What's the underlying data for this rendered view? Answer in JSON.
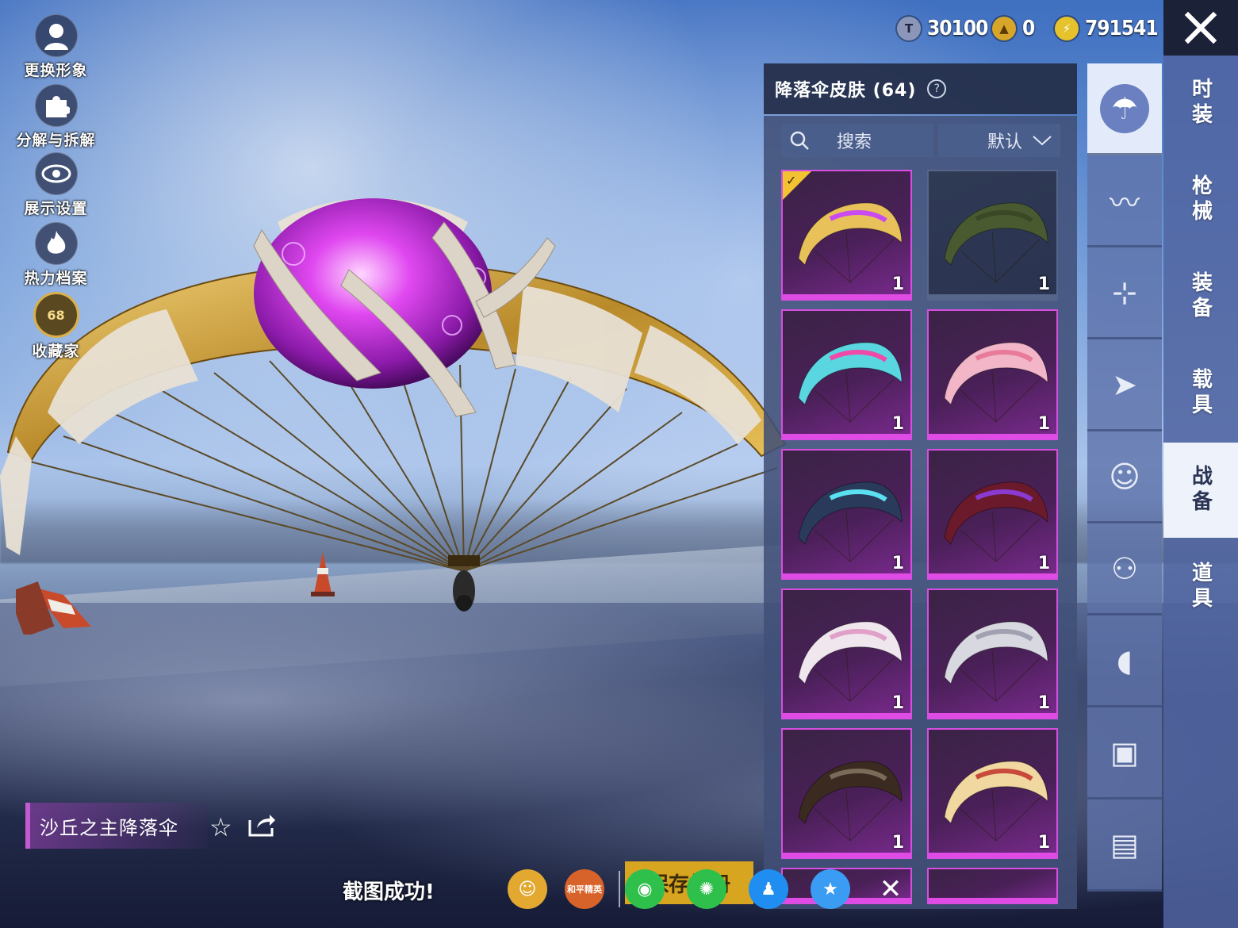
{
  "side_menu": [
    {
      "label": "更换形象",
      "icon": "avatar-icon"
    },
    {
      "label": "分解与拆解",
      "icon": "puzzle-icon"
    },
    {
      "label": "展示设置",
      "icon": "eye-icon"
    },
    {
      "label": "热力档案",
      "icon": "flame-icon"
    },
    {
      "label": "收藏家",
      "icon": "collector-badge-icon",
      "badge": "68"
    }
  ],
  "currencies": [
    {
      "icon": "silver-coin-icon",
      "value": "30100",
      "color": "#9aa4c0"
    },
    {
      "icon": "gold-coin-icon",
      "value": "0",
      "color": "#d6a52a"
    },
    {
      "icon": "energy-coin-icon",
      "value": "791541",
      "color": "#e6c22c"
    }
  ],
  "panel": {
    "title": "降落伞皮肤 (64)",
    "search_label": "搜索",
    "sort_label": "默认",
    "tiles": [
      {
        "name": "tile-dune-lord",
        "count": "1",
        "selected": true,
        "rarity": "purple"
      },
      {
        "name": "tile-olive-default",
        "count": "1",
        "selected": false,
        "rarity": "plain"
      },
      {
        "name": "tile-cyan-pink",
        "count": "1",
        "selected": false,
        "rarity": "purple"
      },
      {
        "name": "tile-pink-flower",
        "count": "1",
        "selected": false,
        "rarity": "purple"
      },
      {
        "name": "tile-cyber-disc",
        "count": "1",
        "selected": false,
        "rarity": "purple"
      },
      {
        "name": "tile-red-purple-diamond",
        "count": "1",
        "selected": false,
        "rarity": "purple"
      },
      {
        "name": "tile-white-pink",
        "count": "1",
        "selected": false,
        "rarity": "purple"
      },
      {
        "name": "tile-silver-crystal",
        "count": "1",
        "selected": false,
        "rarity": "purple"
      },
      {
        "name": "tile-dark-emblem",
        "count": "1",
        "selected": false,
        "rarity": "purple"
      },
      {
        "name": "tile-cartoon-print",
        "count": "1",
        "selected": false,
        "rarity": "purple"
      }
    ]
  },
  "icon_strip": [
    {
      "icon": "parachute-icon",
      "active": true
    },
    {
      "icon": "skydiver-icon",
      "active": false
    },
    {
      "icon": "drone-icon",
      "active": false
    },
    {
      "icon": "airplane-icon",
      "active": false
    },
    {
      "icon": "emote-face-icon",
      "active": false
    },
    {
      "icon": "robot-icon",
      "active": false
    },
    {
      "icon": "speaker-icon",
      "active": false
    },
    {
      "icon": "chat-bubble-icon",
      "active": false
    },
    {
      "icon": "gallery-icon",
      "active": false
    }
  ],
  "category_tabs": [
    {
      "label": "时装",
      "active": false
    },
    {
      "label": "枪械",
      "active": false
    },
    {
      "label": "装备",
      "active": false
    },
    {
      "label": "载具",
      "active": false
    },
    {
      "label": "战备",
      "active": true
    },
    {
      "label": "道具",
      "active": false
    }
  ],
  "selected_item": {
    "name": "沙丘之主降落伞"
  },
  "toast": {
    "text": "截图成功!"
  },
  "share_bar": {
    "save_label": "保存相册",
    "targets": [
      {
        "icon": "contacts-icon",
        "color": "#e2a830"
      },
      {
        "icon": "game-elite-icon",
        "color": "#d8632a",
        "text": "和平精英"
      },
      {
        "icon": "wechat-icon",
        "color": "#2fbf4b"
      },
      {
        "icon": "moments-icon",
        "color": "#2fbf4b"
      },
      {
        "icon": "qq-icon",
        "color": "#1f8ef0"
      },
      {
        "icon": "qzone-icon",
        "color": "#3a9cf2"
      },
      {
        "icon": "close-share-icon",
        "color": "transparent"
      }
    ]
  },
  "colors": {
    "accent": "#d84ee0",
    "selected_check": "#f2c230",
    "tab_bar": "#5064a0"
  }
}
